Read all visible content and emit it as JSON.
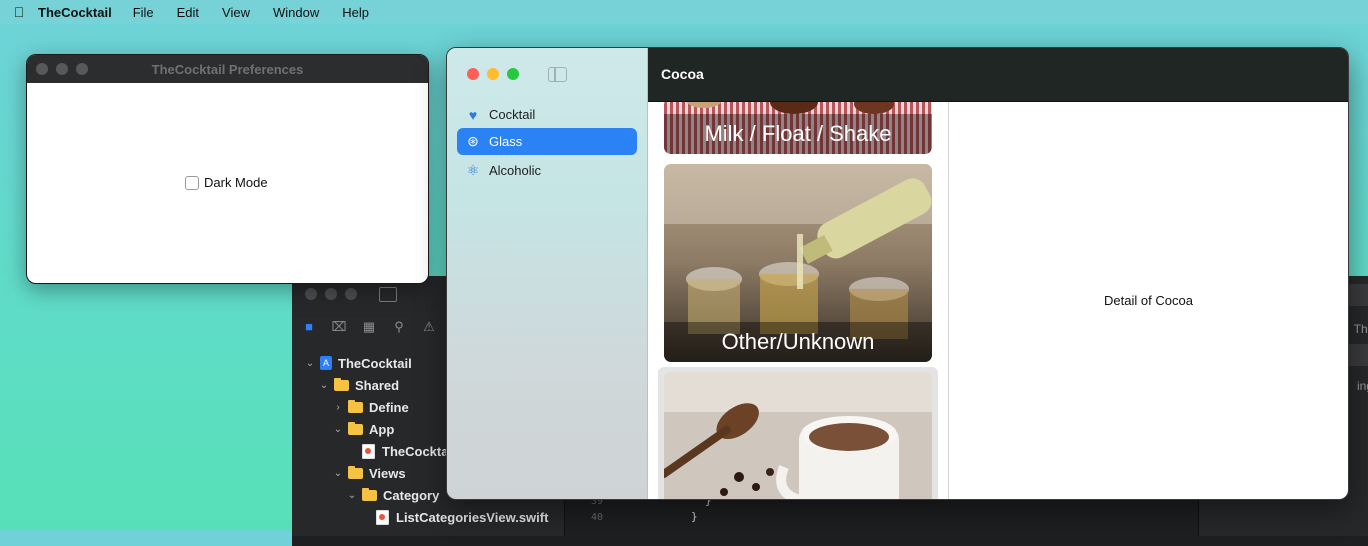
{
  "menubar": {
    "app_name": "TheCocktail",
    "items": [
      "File",
      "Edit",
      "View",
      "Window",
      "Help"
    ]
  },
  "preferences": {
    "title": "TheCocktail Preferences",
    "dark_mode_label": "Dark Mode",
    "dark_mode_checked": false
  },
  "xcode": {
    "tree": [
      {
        "label": "TheCocktail",
        "kind": "project",
        "depth": 0
      },
      {
        "label": "Shared",
        "kind": "folder",
        "depth": 1,
        "expanded": true
      },
      {
        "label": "Define",
        "kind": "folder",
        "depth": 2,
        "expanded": false
      },
      {
        "label": "App",
        "kind": "folder",
        "depth": 2,
        "expanded": true
      },
      {
        "label": "TheCockta",
        "kind": "swift",
        "depth": 3
      },
      {
        "label": "Views",
        "kind": "folder",
        "depth": 2,
        "expanded": true
      },
      {
        "label": "Category",
        "kind": "folder",
        "depth": 3,
        "expanded": true
      },
      {
        "label": "ListCategoriesView.swift",
        "kind": "swift",
        "depth": 4
      }
    ],
    "gutter": [
      "39",
      "40"
    ],
    "code": [
      "}",
      "}"
    ],
    "inspector_fragments": [
      "TheC",
      "ing p"
    ]
  },
  "main": {
    "sidebar": [
      {
        "label": "Cocktail",
        "icon": "heart-icon",
        "selected": false
      },
      {
        "label": "Glass",
        "icon": "asterisk-circle-icon",
        "selected": true
      },
      {
        "label": "Alcoholic",
        "icon": "atom-icon",
        "selected": false
      }
    ],
    "toolbar_title": "Cocoa",
    "cards": [
      {
        "label": "Milk / Float / Shake"
      },
      {
        "label": "Other/Unknown"
      },
      {
        "label": ""
      }
    ],
    "detail_text": "Detail of Cocoa"
  },
  "colors": {
    "accent": "#2a82f5",
    "close": "#fe5f57",
    "minimize": "#febc2e",
    "zoom": "#28c840"
  }
}
